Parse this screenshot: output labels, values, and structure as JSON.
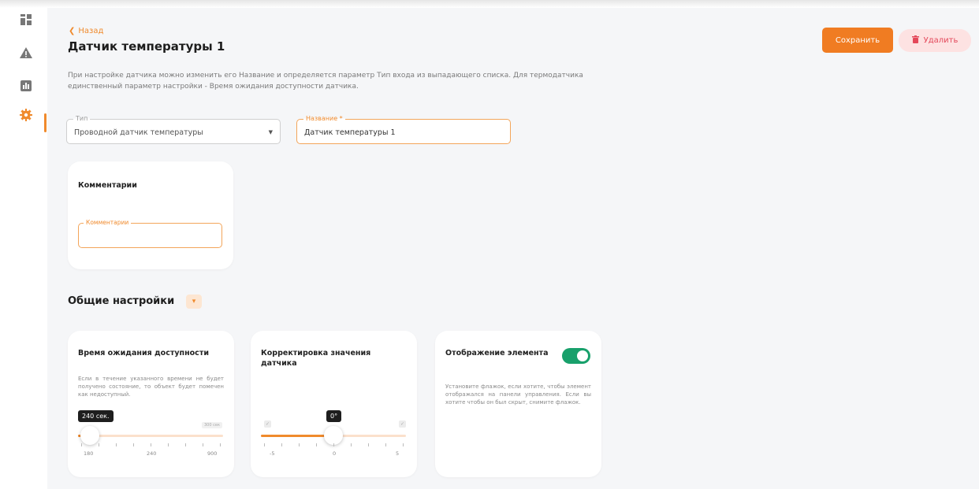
{
  "header": {
    "back_label": "Назад",
    "title": "Датчик температуры 1",
    "save_label": "Сохранить",
    "delete_label": "Удалить"
  },
  "description": "При настройке датчика можно изменить его Название и определяется параметр Тип входа из выпадающего списка. Для термодатчика единственный параметр настройки - Время ожидания доступности датчика.",
  "form": {
    "type_label": "Тип",
    "type_value": "Проводной датчик температуры",
    "name_label": "Название *",
    "name_value": "Датчик температуры 1"
  },
  "comments": {
    "title": "Комментарии",
    "field_label": "Комментарии",
    "field_value": ""
  },
  "general": {
    "title": "Общие настройки"
  },
  "availability": {
    "title": "Время ожидания доступности",
    "text": "Если в течение указанного времени не будет получено состояние, то объект будет помечен как недоступный.",
    "value_label": "240 сек.",
    "mini_label": "300 сек",
    "min_label": "180",
    "mid_label": "240",
    "max_label": "900",
    "level": 0.08
  },
  "correction": {
    "title": "Корректировка значения датчика",
    "value_label": "0°",
    "min_label": "-5",
    "mid_label": "0",
    "max_label": "5",
    "level": 0.5
  },
  "display": {
    "title": "Отображение элемента",
    "text": "Установите флажок, если хотите, чтобы элемент отображался на панели управления. Если вы хотите чтобы он был скрыт, снимите флажок.",
    "enabled": true
  },
  "colors": {
    "accent": "#f07c22",
    "danger": "#e4485a",
    "toggle_on": "#18a06b"
  },
  "icons": {
    "sidebar": [
      "grid-icon",
      "warning-icon",
      "chart-icon",
      "gear-icon"
    ],
    "back": "chevron-left-icon",
    "delete": "trash-icon",
    "section_toggle": "chevron-down-icon",
    "select_arrow": "caret-down-icon"
  }
}
